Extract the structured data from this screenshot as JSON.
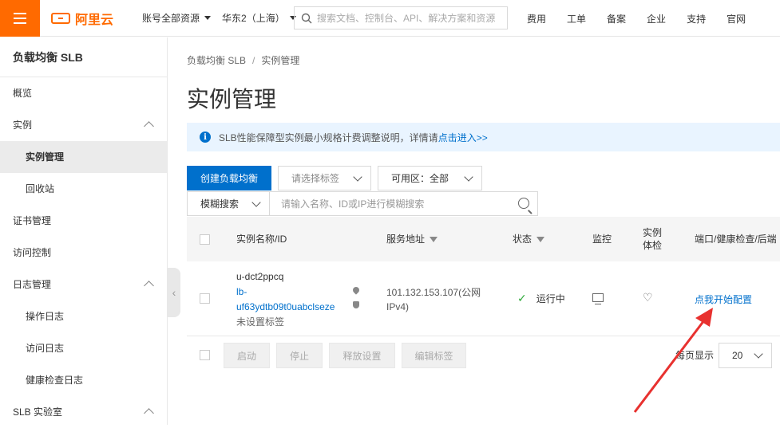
{
  "topbar": {
    "logo_text": "阿里云",
    "account_scope": "账号全部资源",
    "region": "华东2（上海）",
    "search_placeholder": "搜索文档、控制台、API、解决方案和资源",
    "links": [
      "费用",
      "工单",
      "备案",
      "企业",
      "支持",
      "官网"
    ],
    "brand_color": "#ff6a00"
  },
  "sidebar": {
    "title": "负载均衡 SLB",
    "items": [
      {
        "label": "概览"
      },
      {
        "label": "实例"
      },
      {
        "label": "实例管理"
      },
      {
        "label": "回收站"
      },
      {
        "label": "证书管理"
      },
      {
        "label": "访问控制"
      },
      {
        "label": "日志管理"
      },
      {
        "label": "操作日志"
      },
      {
        "label": "访问日志"
      },
      {
        "label": "健康检查日志"
      },
      {
        "label": "SLB 实验室"
      }
    ]
  },
  "main": {
    "breadcrumb": [
      "负载均衡 SLB",
      "实例管理"
    ],
    "breadcrumb_sep": "/",
    "title": "实例管理",
    "notice": {
      "text": "SLB性能保障型实例最小规格计费调整说明，详情请",
      "link": "点击进入>>"
    },
    "create_button": "创建负载均衡",
    "tag_select_placeholder": "请选择标签",
    "zone_select": "可用区：全部",
    "search_mode": "模糊搜索",
    "search_placeholder": "请输入名称、ID或IP进行模糊搜索",
    "table": {
      "headers": {
        "name": "实例名称/ID",
        "address": "服务地址",
        "status": "状态",
        "monitor": "监控",
        "health_line1": "实例",
        "health_line2": "体检",
        "ports": "端口/健康检查/后端"
      },
      "rows": [
        {
          "name": "u-dct2ppcq",
          "id_line1": "lb-",
          "id_line2": "uf63ydtb09t0uabclseze",
          "tag": "未设置标签",
          "address_line1": "101.132.153.107(公网",
          "address_line2": "IPv4)",
          "status": "运行中",
          "action": "点我开始配置"
        }
      ]
    },
    "footer_buttons": [
      "启动",
      "停止",
      "释放设置",
      "编辑标签"
    ],
    "per_page_label": "每页显示",
    "per_page_value": "20"
  }
}
